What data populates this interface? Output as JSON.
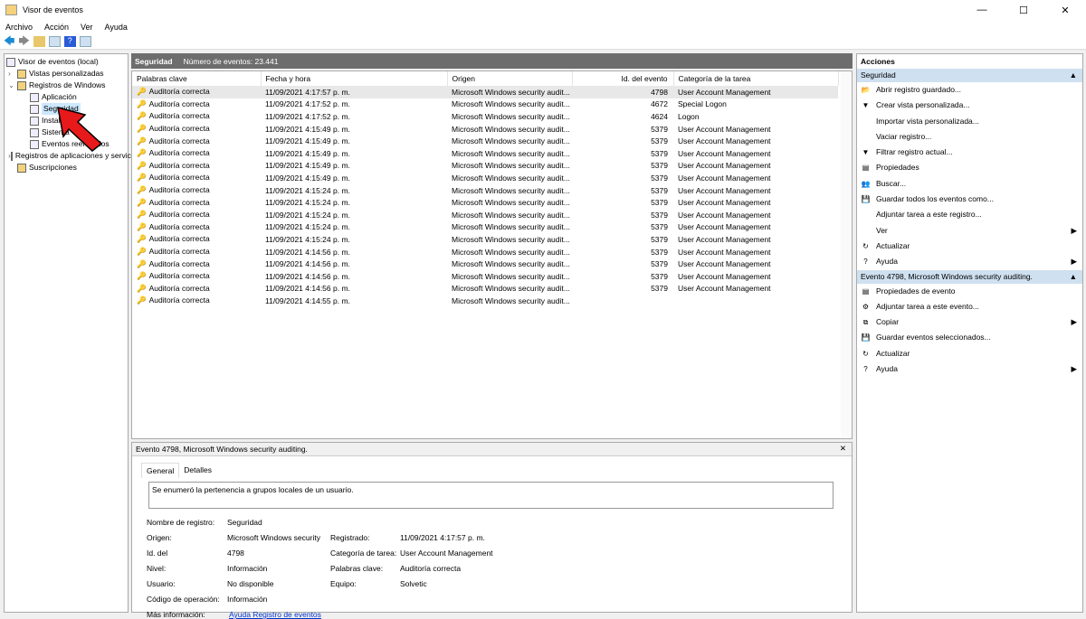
{
  "window": {
    "title": "Visor de eventos",
    "minimize": "—",
    "maximize": "☐",
    "close": "✕"
  },
  "menu": [
    "Archivo",
    "Acción",
    "Ver",
    "Ayuda"
  ],
  "tree": [
    {
      "label": "Visor de eventos (local)",
      "level": 0,
      "exp": ""
    },
    {
      "label": "Vistas personalizadas",
      "level": 1,
      "exp": "›"
    },
    {
      "label": "Registros de Windows",
      "level": 1,
      "exp": "⌄"
    },
    {
      "label": "Aplicación",
      "level": 2,
      "exp": ""
    },
    {
      "label": "Seguridad",
      "level": 2,
      "exp": "",
      "selected": true
    },
    {
      "label": "Instalación",
      "level": 2,
      "exp": ""
    },
    {
      "label": "Sistema",
      "level": 2,
      "exp": ""
    },
    {
      "label": "Eventos reenviados",
      "level": 2,
      "exp": ""
    },
    {
      "label": "Registros de aplicaciones y servicios",
      "level": 1,
      "exp": "›"
    },
    {
      "label": "Suscripciones",
      "level": 1,
      "exp": ""
    }
  ],
  "log_header": {
    "name": "Seguridad",
    "count": "Número de eventos: 23.441"
  },
  "columns": [
    "Palabras clave",
    "Fecha y hora",
    "Origen",
    "Id. del evento",
    "Categoría de la tarea"
  ],
  "rows": [
    [
      "Auditoría correcta",
      "11/09/2021 4:17:57 p. m.",
      "Microsoft Windows security audit...",
      "4798",
      "User Account Management"
    ],
    [
      "Auditoría correcta",
      "11/09/2021 4:17:52 p. m.",
      "Microsoft Windows security audit...",
      "4672",
      "Special Logon"
    ],
    [
      "Auditoría correcta",
      "11/09/2021 4:17:52 p. m.",
      "Microsoft Windows security audit...",
      "4624",
      "Logon"
    ],
    [
      "Auditoría correcta",
      "11/09/2021 4:15:49 p. m.",
      "Microsoft Windows security audit...",
      "5379",
      "User Account Management"
    ],
    [
      "Auditoría correcta",
      "11/09/2021 4:15:49 p. m.",
      "Microsoft Windows security audit...",
      "5379",
      "User Account Management"
    ],
    [
      "Auditoría correcta",
      "11/09/2021 4:15:49 p. m.",
      "Microsoft Windows security audit...",
      "5379",
      "User Account Management"
    ],
    [
      "Auditoría correcta",
      "11/09/2021 4:15:49 p. m.",
      "Microsoft Windows security audit...",
      "5379",
      "User Account Management"
    ],
    [
      "Auditoría correcta",
      "11/09/2021 4:15:49 p. m.",
      "Microsoft Windows security audit...",
      "5379",
      "User Account Management"
    ],
    [
      "Auditoría correcta",
      "11/09/2021 4:15:24 p. m.",
      "Microsoft Windows security audit...",
      "5379",
      "User Account Management"
    ],
    [
      "Auditoría correcta",
      "11/09/2021 4:15:24 p. m.",
      "Microsoft Windows security audit...",
      "5379",
      "User Account Management"
    ],
    [
      "Auditoría correcta",
      "11/09/2021 4:15:24 p. m.",
      "Microsoft Windows security audit...",
      "5379",
      "User Account Management"
    ],
    [
      "Auditoría correcta",
      "11/09/2021 4:15:24 p. m.",
      "Microsoft Windows security audit...",
      "5379",
      "User Account Management"
    ],
    [
      "Auditoría correcta",
      "11/09/2021 4:15:24 p. m.",
      "Microsoft Windows security audit...",
      "5379",
      "User Account Management"
    ],
    [
      "Auditoría correcta",
      "11/09/2021 4:14:56 p. m.",
      "Microsoft Windows security audit...",
      "5379",
      "User Account Management"
    ],
    [
      "Auditoría correcta",
      "11/09/2021 4:14:56 p. m.",
      "Microsoft Windows security audit...",
      "5379",
      "User Account Management"
    ],
    [
      "Auditoría correcta",
      "11/09/2021 4:14:56 p. m.",
      "Microsoft Windows security audit...",
      "5379",
      "User Account Management"
    ],
    [
      "Auditoría correcta",
      "11/09/2021 4:14:56 p. m.",
      "Microsoft Windows security audit...",
      "5379",
      "User Account Management"
    ],
    [
      "Auditoría correcta",
      "11/09/2021 4:14:55 p. m.",
      "Microsoft Windows security audit...",
      "",
      ""
    ]
  ],
  "detail": {
    "title": "Evento 4798, Microsoft Windows security auditing.",
    "tabs": [
      "General",
      "Detalles"
    ],
    "description": "Se enumeró la pertenencia a grupos locales de un usuario.",
    "fields": {
      "log_name_label": "Nombre de registro:",
      "log_name": "Seguridad",
      "source_label": "Origen:",
      "source": "Microsoft Windows security",
      "logged_label": "Registrado:",
      "logged": "11/09/2021 4:17:57 p. m.",
      "id_label": "Id. del",
      "id": "4798",
      "category_label": "Categoría de tarea:",
      "category": "User Account Management",
      "level_label": "Nivel:",
      "level": "Información",
      "keywords_label": "Palabras clave:",
      "keywords": "Auditoría correcta",
      "user_label": "Usuario:",
      "user": "No disponible",
      "computer_label": "Equipo:",
      "computer": "Solvetic",
      "opcode_label": "Código de operación:",
      "opcode": "Información",
      "more_label": "Más información:",
      "more_link": "Ayuda Registro de eventos"
    }
  },
  "actions": {
    "title": "Acciones",
    "section1": "Seguridad",
    "items1": [
      {
        "label": "Abrir registro guardado...",
        "icon": "📂",
        "sub": false
      },
      {
        "label": "Crear vista personalizada...",
        "icon": "▼",
        "sub": false
      },
      {
        "label": "Importar vista personalizada...",
        "icon": "",
        "sub": false
      },
      {
        "label": "Vaciar registro...",
        "icon": "",
        "sub": false
      },
      {
        "label": "Filtrar registro actual...",
        "icon": "▼",
        "sub": false
      },
      {
        "label": "Propiedades",
        "icon": "▤",
        "sub": false
      },
      {
        "label": "Buscar...",
        "icon": "👥",
        "sub": false
      },
      {
        "label": "Guardar todos los eventos como...",
        "icon": "💾",
        "sub": false
      },
      {
        "label": "Adjuntar tarea a este registro...",
        "icon": "",
        "sub": false
      },
      {
        "label": "Ver",
        "icon": "",
        "sub": true
      },
      {
        "label": "Actualizar",
        "icon": "↻",
        "sub": false
      },
      {
        "label": "Ayuda",
        "icon": "?",
        "sub": true
      }
    ],
    "section2": "Evento 4798, Microsoft Windows security auditing.",
    "items2": [
      {
        "label": "Propiedades de evento",
        "icon": "▤",
        "sub": false
      },
      {
        "label": "Adjuntar tarea a este evento...",
        "icon": "⚙",
        "sub": false
      },
      {
        "label": "Copiar",
        "icon": "⧉",
        "sub": true
      },
      {
        "label": "Guardar eventos seleccionados...",
        "icon": "💾",
        "sub": false
      },
      {
        "label": "Actualizar",
        "icon": "↻",
        "sub": false
      },
      {
        "label": "Ayuda",
        "icon": "?",
        "sub": true
      }
    ]
  },
  "colors": {
    "header_bg": "#6d6d6d",
    "section_bg": "#cfe0f0",
    "selection": "#cce8ff",
    "arrow": "#e8191b"
  }
}
